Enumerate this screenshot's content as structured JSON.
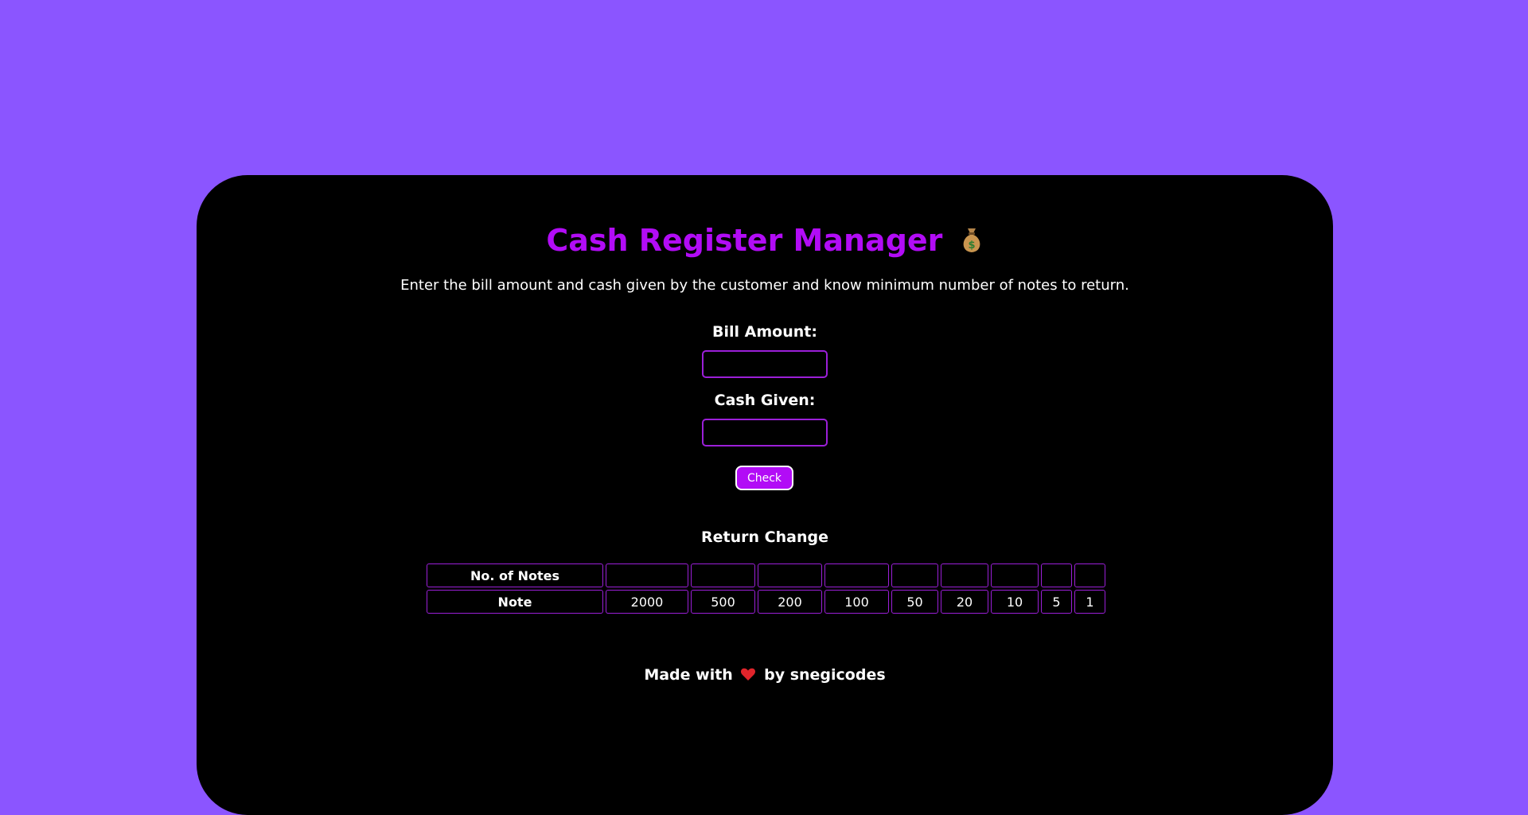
{
  "app": {
    "title": "Cash Register Manager",
    "title_icon": "money-bag-icon",
    "description": "Enter the bill amount and cash given by the customer and know minimum number of notes to return."
  },
  "form": {
    "bill_label": "Bill Amount:",
    "bill_value": "",
    "cash_label": "Cash Given:",
    "cash_value": "",
    "check_label": "Check"
  },
  "result": {
    "title": "Return Change",
    "row_count_header": "No. of Notes",
    "row_note_header": "Note",
    "notes": [
      "2000",
      "500",
      "200",
      "100",
      "50",
      "20",
      "10",
      "5",
      "1"
    ],
    "counts": [
      "",
      "",
      "",
      "",
      "",
      "",
      "",
      "",
      ""
    ]
  },
  "footer": {
    "prefix": "Made with",
    "icon": "heart-icon",
    "suffix": "by snegicodes"
  },
  "colors": {
    "page_background": "#8b55ff",
    "card_background": "#000000",
    "accent": "#b20cf6",
    "border": "#9b1fd8"
  }
}
